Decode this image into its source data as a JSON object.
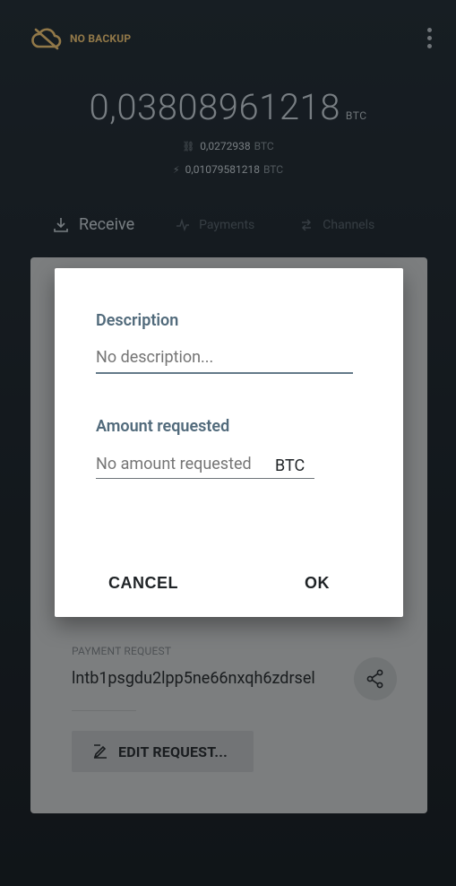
{
  "header": {
    "backup_label": "NO BACKUP",
    "backup_color": "#f2c879"
  },
  "balance": {
    "total_int": "0,",
    "total_dec": "03808961218",
    "total_currency": "BTC",
    "onchain_value": "0,0272938",
    "onchain_currency": "BTC",
    "lightning_value": "0,01079581218",
    "lightning_currency": "BTC"
  },
  "tabs": {
    "receive": "Receive",
    "payments": "Payments",
    "channels": "Channels"
  },
  "card": {
    "payment_request_label": "PAYMENT REQUEST",
    "payment_request_value": "lntb1psgdu2lpp5ne66nxqh6zdrsel",
    "edit_button_label": "EDIT REQUEST..."
  },
  "dialog": {
    "description_label": "Description",
    "description_placeholder": "No description...",
    "amount_label": "Amount requested",
    "amount_placeholder": "No amount requested",
    "amount_unit": "BTC",
    "cancel_label": "CANCEL",
    "ok_label": "OK"
  },
  "icons": {
    "cloud_off": "cloud-off-icon",
    "menu": "more-vert-icon",
    "onchain": "link-icon",
    "lightning": "bolt-icon",
    "download": "download-icon",
    "payments": "pulse-icon",
    "channels": "swap-icon",
    "share": "share-icon",
    "edit": "edit-icon"
  }
}
